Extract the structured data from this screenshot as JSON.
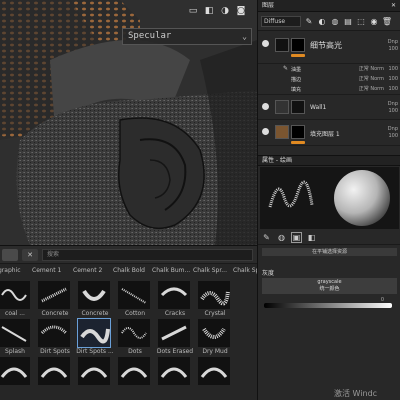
{
  "viewport": {
    "channel_label": "Specular",
    "toolbar_icons": [
      "frame-icon",
      "cube-icon",
      "mode-icon",
      "camera-icon"
    ]
  },
  "shelf": {
    "search_placeholder": "搜索",
    "header_labels": [
      "graphic",
      "Cement 1",
      "Cement 2",
      "Chalk Bold",
      "Chalk Bum...",
      "Chalk Spr...",
      "Chalk Spr..."
    ],
    "rows": [
      [
        "coal ...",
        "Concrete",
        "Concrete",
        "Cotton",
        "Cracks",
        "Crystal",
        "Dirt Spots"
      ],
      [
        "Splash",
        "Dirt Spots",
        "Dirt Spots ...",
        "Dots",
        "Dots Erased",
        "Dry Mud",
        "Dus..."
      ]
    ],
    "selected_item": "Dirt Spots ..."
  },
  "layers": {
    "panel_title": "图层",
    "blend_mode": "Diffuse",
    "items": [
      {
        "name": "细节高光",
        "mode": "正常",
        "opacity": "100",
        "sub_mode": "Dnp",
        "sub_opacity": "100"
      },
      {
        "name": "描边",
        "mode": "正常 Norm",
        "opacity": "100"
      },
      {
        "name": "填充",
        "mode": "正常 Norm",
        "opacity": "100"
      },
      {
        "name": "Wall1",
        "mode": "正常",
        "opacity": "100",
        "sub_mode": "Dnp",
        "sub_opacity": "100"
      },
      {
        "name": "填充图层 1",
        "mode": "正常",
        "opacity": "100",
        "sub_mode": "Dnp",
        "sub_opacity": "100"
      }
    ],
    "sub_item": {
      "name": "油墨",
      "mode": "正常 Norm",
      "opacity": "100"
    }
  },
  "properties": {
    "title": "属性 - 绘画",
    "source_button": "在平铺选择资源",
    "grayscale_label": "灰度",
    "grayscale_value_title": "grayscale",
    "grayscale_value_sub": "统一颜色",
    "slider_value": "0"
  },
  "watermark": "激活 Windc",
  "colors": {
    "accent_orange": "#e08a22",
    "selection_blue": "#6aa0d8"
  }
}
